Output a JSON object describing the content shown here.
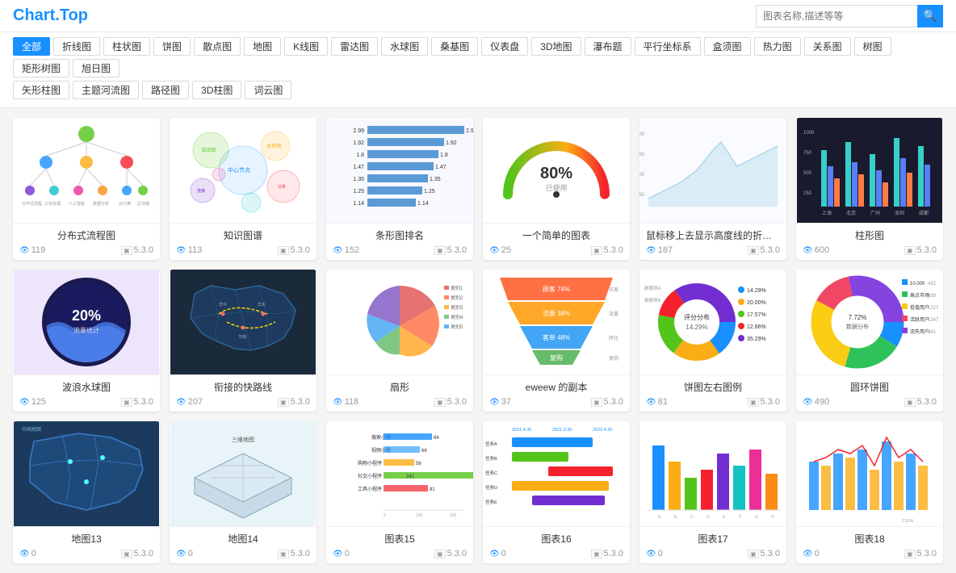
{
  "header": {
    "logo": "Chart.Top",
    "search_placeholder": "图表名称,描述等等",
    "search_btn_icon": "🔍"
  },
  "filter": {
    "row1": [
      {
        "label": "全部",
        "active": true
      },
      {
        "label": "折线图",
        "active": false
      },
      {
        "label": "柱状图",
        "active": false
      },
      {
        "label": "饼图",
        "active": false
      },
      {
        "label": "散点图",
        "active": false
      },
      {
        "label": "地图",
        "active": false
      },
      {
        "label": "K线图",
        "active": false
      },
      {
        "label": "雷达图",
        "active": false
      },
      {
        "label": "水球图",
        "active": false
      },
      {
        "label": "桑基图",
        "active": false
      },
      {
        "label": "仪表盘",
        "active": false
      },
      {
        "label": "3D地图",
        "active": false
      },
      {
        "label": "瀑布题",
        "active": false
      },
      {
        "label": "平行坐标系",
        "active": false
      },
      {
        "label": "盒须图",
        "active": false
      },
      {
        "label": "热力图",
        "active": false
      },
      {
        "label": "关系图",
        "active": false
      },
      {
        "label": "树图",
        "active": false
      },
      {
        "label": "矩形树图",
        "active": false
      },
      {
        "label": "旭日图",
        "active": false
      }
    ],
    "row2": [
      {
        "label": "矢形柱图",
        "active": false
      },
      {
        "label": "主题河流图",
        "active": false
      },
      {
        "label": "路径图",
        "active": false
      },
      {
        "label": "3D柱图",
        "active": false
      },
      {
        "label": "词云图",
        "active": false
      }
    ]
  },
  "charts": [
    {
      "id": 1,
      "title": "分布式流程图",
      "views": 119,
      "version": "5.3.0",
      "type": "flow"
    },
    {
      "id": 2,
      "title": "知识图谱",
      "views": 113,
      "version": "5.3.0",
      "type": "knowledge"
    },
    {
      "id": 3,
      "title": "条形图排名",
      "views": 152,
      "version": "5.3.0",
      "type": "bar"
    },
    {
      "id": 4,
      "title": "一个简单的图表",
      "views": 25,
      "version": "5.3.0",
      "type": "gauge"
    },
    {
      "id": 5,
      "title": "鼠标移上去显示高度线的折线图",
      "views": 187,
      "version": "5.3.0",
      "type": "line"
    },
    {
      "id": 6,
      "title": "柱形图",
      "views": 600,
      "version": "5.3.0",
      "type": "column"
    },
    {
      "id": 7,
      "title": "波浪水球图",
      "views": 125,
      "version": "5.3.0",
      "type": "water"
    },
    {
      "id": 8,
      "title": "衔接的快路线",
      "views": 207,
      "version": "5.3.0",
      "type": "map"
    },
    {
      "id": 9,
      "title": "扇形",
      "views": 118,
      "version": "5.3.0",
      "type": "fan"
    },
    {
      "id": 10,
      "title": "eweew 的副本",
      "views": 37,
      "version": "5.3.0",
      "type": "funnel"
    },
    {
      "id": 11,
      "title": "饼图左右图例",
      "views": 81,
      "version": "5.3.0",
      "type": "donut_lr"
    },
    {
      "id": 12,
      "title": "圆环饼图",
      "views": 490,
      "version": "5.3.0",
      "type": "ring"
    },
    {
      "id": 13,
      "title": "地图13",
      "views": 0,
      "version": "5.3.0",
      "type": "map2"
    },
    {
      "id": 14,
      "title": "地图14",
      "views": 0,
      "version": "5.3.0",
      "type": "map3"
    },
    {
      "id": 15,
      "title": "图表15",
      "views": 0,
      "version": "5.3.0",
      "type": "bar2"
    },
    {
      "id": 16,
      "title": "图表16",
      "views": 0,
      "version": "5.3.0",
      "type": "gantt"
    },
    {
      "id": 17,
      "title": "图表17",
      "views": 0,
      "version": "5.3.0",
      "type": "bar3"
    },
    {
      "id": 18,
      "title": "图表18",
      "views": 0,
      "version": "5.3.0",
      "type": "bar4"
    }
  ],
  "icons": {
    "eye": "👁",
    "version": "⬚",
    "search": "🔍",
    "arrow_right": "▶"
  }
}
